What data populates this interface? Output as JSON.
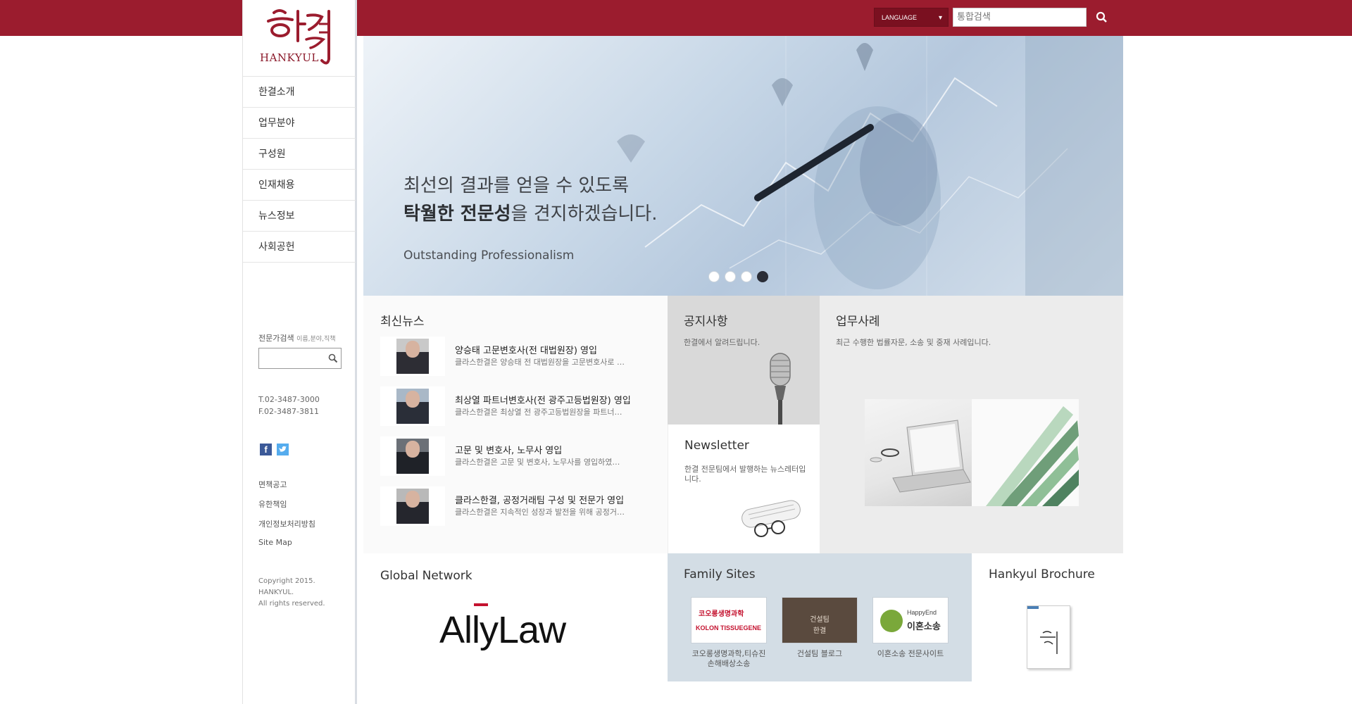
{
  "header": {
    "language_label": "LANGUAGE",
    "search_placeholder": "통합검색"
  },
  "sidebar": {
    "logo_text": "HANKYUL",
    "nav": [
      "한결소개",
      "업무분야",
      "구성원",
      "인재채용",
      "뉴스정보",
      "사회공헌"
    ],
    "expert_search_label": "전문가검색",
    "expert_search_hint": "이름,분야,직책",
    "phone": "T.02-3487-3000",
    "fax": "F.02-3487-3811",
    "footer_links": [
      "면책공고",
      "유한책임",
      "개인정보처리방침",
      "Site Map"
    ],
    "copyright": [
      "Copyright 2015.",
      "HANKYUL.",
      "All rights reserved."
    ]
  },
  "hero": {
    "line1": "최선의 결과를 얻을 수 있도록",
    "line2_bold": "탁월한 전문성",
    "line2_rest": "을 견지하겠습니다.",
    "subtitle": "Outstanding Professionalism",
    "slide_count": 4,
    "active_slide": 4
  },
  "news": {
    "title": "최신뉴스",
    "items": [
      {
        "headline": "양승태 고문변호사(전 대법원장) 영입",
        "desc": "클라스한결은 양승태 전 대법원장을 고문변호사로 …"
      },
      {
        "headline": "최상열 파트너변호사(전 광주고등법원장) 영입",
        "desc": "클라스한결은 최상열 전 광주고등법원장을 파트너…"
      },
      {
        "headline": "고문 및 변호사, 노무사 영입",
        "desc": "클라스한결은 고문 및 변호사, 노무사를 영입하였…"
      },
      {
        "headline": "클라스한결, 공정거래팀 구성 및 전문가 영입",
        "desc": "클라스한결은 지속적인 성장과 발전을 위해 공정거…"
      }
    ]
  },
  "notice": {
    "title": "공지사항",
    "desc": "한결에서 알려드립니다."
  },
  "newsletter": {
    "title": "Newsletter",
    "desc": "한결 전문팀에서 발행하는 뉴스레터입니다."
  },
  "cases": {
    "title": "업무사례",
    "desc": "최근 수행한 법률자문, 소송 및 중재 사례입니다."
  },
  "global_network": {
    "title": "Global Network",
    "logo_text": "AllyLaw"
  },
  "family_sites": {
    "title": "Family Sites",
    "sites": [
      {
        "label": "코오롱생명과학,티슈진 손해배상소송",
        "logo_line1": "코오롱생명과학",
        "logo_line2": "KOLON TISSUEGENE"
      },
      {
        "label": "건설팀 블로그",
        "logo_line1": "건설팀",
        "logo_line2": "한결"
      },
      {
        "label": "이혼소송 전문사이트",
        "logo_line1": "HappyEnd",
        "logo_line2": "이혼소송"
      }
    ]
  },
  "brochure": {
    "title": "Hankyul Brochure"
  },
  "colors": {
    "brand": "#9b1c2e",
    "notice_bg": "#d9d9d9",
    "family_bg": "#d3dde5"
  }
}
